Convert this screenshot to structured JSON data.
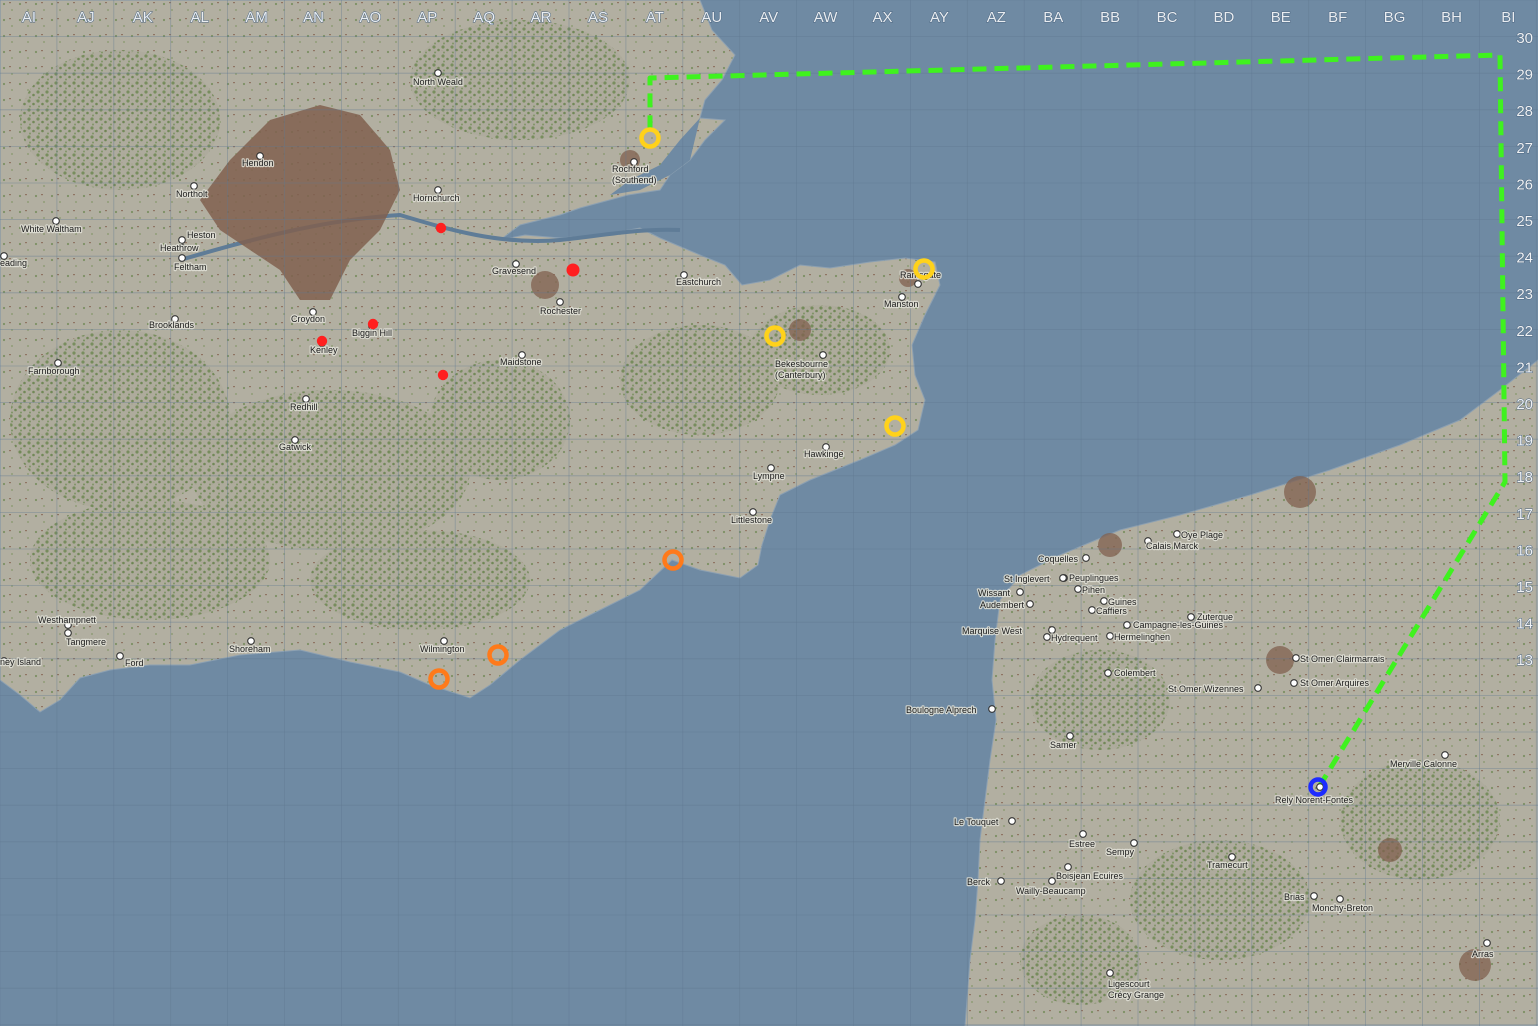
{
  "colors": {
    "sea": "#6f8aa3",
    "land": "#aeab9c",
    "forest": "#6e8553",
    "urban": "#80604f",
    "grid": "#5f7890",
    "route": "#3ff21f",
    "target_red": "#ff1f1f",
    "marker_yellow": "#ffd21a",
    "marker_orange": "#ff7a1a",
    "marker_blue": "#1d2bff"
  },
  "grid": {
    "columns": [
      "AI",
      "AJ",
      "AK",
      "AL",
      "AM",
      "AN",
      "AO",
      "AP",
      "AQ",
      "AR",
      "AS",
      "AT",
      "AU",
      "AV",
      "AW",
      "AX",
      "AY",
      "AZ",
      "BA",
      "BB",
      "BC",
      "BD",
      "BE",
      "BF",
      "BG",
      "BH",
      "BI"
    ],
    "rows": [
      "30",
      "29",
      "28",
      "27",
      "26",
      "25",
      "24",
      "23",
      "22",
      "21",
      "20",
      "19",
      "18",
      "17",
      "16",
      "15",
      "14",
      "13"
    ]
  },
  "places": [
    {
      "name": "North Weald"
    },
    {
      "name": "Hendon"
    },
    {
      "name": "Northolt"
    },
    {
      "name": "Hornchurch"
    },
    {
      "name": "White Waltham"
    },
    {
      "name": "Heston"
    },
    {
      "name": "Heathrow"
    },
    {
      "name": "Feltham"
    },
    {
      "name": "eading"
    },
    {
      "name": "Gravesend"
    },
    {
      "name": "Rochford\n(Southend)"
    },
    {
      "name": "Eastchurch"
    },
    {
      "name": "Rochester"
    },
    {
      "name": "Croydon"
    },
    {
      "name": "Biggin Hill"
    },
    {
      "name": "Kenley"
    },
    {
      "name": "Brooklands"
    },
    {
      "name": "Farnborough"
    },
    {
      "name": "Maidstone"
    },
    {
      "name": "Redhill"
    },
    {
      "name": "Gatwick"
    },
    {
      "name": "Ramsgate"
    },
    {
      "name": "Manston"
    },
    {
      "name": "Bekesbourne\n(Canterbury)"
    },
    {
      "name": "Hawkinge"
    },
    {
      "name": "Lympne"
    },
    {
      "name": "Littlestone"
    },
    {
      "name": "Westhampnett"
    },
    {
      "name": "Tangmere"
    },
    {
      "name": "Ford"
    },
    {
      "name": "ney Island"
    },
    {
      "name": "Shoreham"
    },
    {
      "name": "Wilmington"
    },
    {
      "name": "Oye Plage"
    },
    {
      "name": "Calais Marck"
    },
    {
      "name": "Coquelles"
    },
    {
      "name": "St Inglevert"
    },
    {
      "name": "Peuplingues"
    },
    {
      "name": "Wissant"
    },
    {
      "name": "Pihen"
    },
    {
      "name": "Audembert"
    },
    {
      "name": "Guines"
    },
    {
      "name": "Caffiers"
    },
    {
      "name": "Zuterque"
    },
    {
      "name": "Campagne-les-Guines"
    },
    {
      "name": "Marquise West"
    },
    {
      "name": "Hydrequent"
    },
    {
      "name": "Hermelinghen"
    },
    {
      "name": "St Omer Clairmarrais"
    },
    {
      "name": "Colembert"
    },
    {
      "name": "St Omer Arquires"
    },
    {
      "name": "St Omer Wizennes"
    },
    {
      "name": "Boulogne Alprech"
    },
    {
      "name": "Samer"
    },
    {
      "name": "Merville Calonne"
    },
    {
      "name": "Rely Norent-Fontes"
    },
    {
      "name": "Le Touquet"
    },
    {
      "name": "Estree"
    },
    {
      "name": "Sempy"
    },
    {
      "name": "Tramecurt"
    },
    {
      "name": "Berck"
    },
    {
      "name": "Boisjean Ecuires"
    },
    {
      "name": "Wailly-Beaucamp"
    },
    {
      "name": "Brias"
    },
    {
      "name": "Monchy-Breton"
    },
    {
      "name": "Arras"
    },
    {
      "name": "Ligescourt\nCrécy Grange"
    }
  ],
  "markers": [
    {
      "type": "target",
      "color": "#ff1f1f",
      "label": ""
    },
    {
      "type": "target",
      "color": "#ff1f1f",
      "label": ""
    },
    {
      "type": "target",
      "color": "#ff1f1f",
      "label": ""
    },
    {
      "type": "target",
      "color": "#ff1f1f",
      "label": ""
    },
    {
      "type": "target",
      "color": "#ff1f1f",
      "label": ""
    },
    {
      "type": "ring",
      "color": "#ffd21a",
      "label": ""
    },
    {
      "type": "ring",
      "color": "#ffd21a",
      "label": ""
    },
    {
      "type": "ring",
      "color": "#ffd21a",
      "label": ""
    },
    {
      "type": "ring",
      "color": "#ffd21a",
      "label": ""
    },
    {
      "type": "ring",
      "color": "#ff7a1a",
      "label": ""
    },
    {
      "type": "ring",
      "color": "#ff7a1a",
      "label": ""
    },
    {
      "type": "ring",
      "color": "#ff7a1a",
      "label": ""
    },
    {
      "type": "ring",
      "color": "#1d2bff",
      "label": ""
    }
  ],
  "route": {
    "style": "dashed",
    "color": "#3ff21f",
    "from": "Rely Norent-Fontes",
    "to": "Rochford (Southend)"
  }
}
